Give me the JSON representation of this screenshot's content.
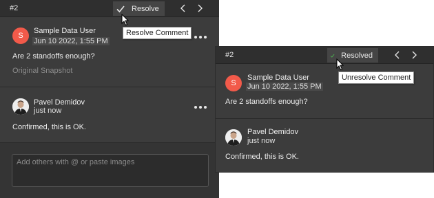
{
  "left_panel": {
    "thread_number": "#2",
    "resolve_button": {
      "label": "Resolve",
      "icon": "check-icon",
      "icon_color": "#e8e8e8"
    },
    "tooltip": "Resolve Comment",
    "comments": [
      {
        "author": "Sample Data User",
        "avatar_letter": "S",
        "avatar_color": "#f25a4a",
        "timestamp": "Jun 10 2022, 1:55 PM",
        "text": "Are 2 standoffs enough?",
        "snapshot_label": "Original Snapshot"
      },
      {
        "author": "Pavel Demidov",
        "avatar": "photo-avatar",
        "timestamp": "just now",
        "text": "Confirmed, this is OK."
      }
    ],
    "reply_placeholder": "Add others with @ or paste images"
  },
  "right_panel": {
    "thread_number": "#2",
    "resolve_button": {
      "label": "Resolved",
      "icon": "check-icon",
      "icon_color": "#4caf50"
    },
    "tooltip": "Unresolve Comment",
    "comments": [
      {
        "author": "Sample Data User",
        "avatar_letter": "S",
        "avatar_color": "#f25a4a",
        "timestamp": "Jun 10 2022, 1:55 PM",
        "text": "Are 2 standoffs enough?"
      },
      {
        "author": "Pavel Demidov",
        "avatar": "photo-avatar",
        "timestamp": "just now",
        "text": "Confirmed, this is OK."
      }
    ]
  },
  "colors": {
    "panel_bg": "#3c3c3c",
    "header_bg": "#2f2f2f",
    "avatar_accent": "#f25a4a",
    "resolved_check": "#4caf50"
  }
}
